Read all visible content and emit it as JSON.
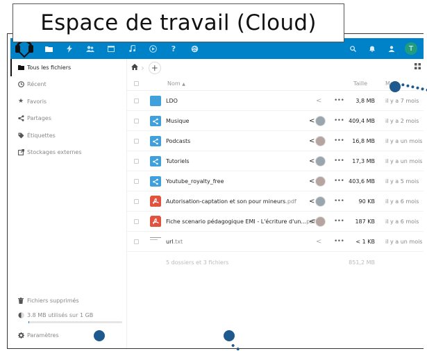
{
  "title": "Espace de travail (Cloud)",
  "topbar": {
    "nav_icons": [
      "files-icon",
      "activity-icon",
      "contacts-icon",
      "calendar-icon",
      "music-icon",
      "video-icon",
      "help-icon",
      "globe-icon"
    ],
    "right_icons": [
      "search-icon",
      "notifications-icon",
      "contacts-menu-icon"
    ],
    "avatar_letter": "T",
    "accent": "#0082c9"
  },
  "sidebar": {
    "items": [
      {
        "label": "Tous les fichiers",
        "icon": "folder-icon"
      },
      {
        "label": "Récent",
        "icon": "clock-icon"
      },
      {
        "label": "Favoris",
        "icon": "star-icon"
      },
      {
        "label": "Partages",
        "icon": "share-icon"
      },
      {
        "label": "Étiquettes",
        "icon": "tag-icon"
      },
      {
        "label": "Stockages externes",
        "icon": "external-icon"
      }
    ],
    "trash_label": "Fichiers supprimés",
    "quota_label": "3.8 MB utilisés sur 1 GB",
    "quota_fraction": 0.004,
    "settings_label": "Paramètres"
  },
  "table": {
    "col_name": "Nom",
    "col_size": "Taille",
    "col_modified": "Mo",
    "rows": [
      {
        "name": "LDO",
        "ext": "",
        "type": "folder",
        "shared": false,
        "size": "3,8 MB",
        "modified": "il y a 7 mois"
      },
      {
        "name": "Musique",
        "ext": "",
        "type": "shared",
        "shared": true,
        "size": "409,4 MB",
        "modified": "il y a 2 mois"
      },
      {
        "name": "Podcasts",
        "ext": "",
        "type": "shared",
        "shared": true,
        "size": "16,8 MB",
        "modified": "il y a un mois"
      },
      {
        "name": "Tutoriels",
        "ext": "",
        "type": "shared",
        "shared": true,
        "size": "17,3 MB",
        "modified": "il y a un mois"
      },
      {
        "name": "Youtube_royalty_free",
        "ext": "",
        "type": "shared",
        "shared": true,
        "size": "403,6 MB",
        "modified": "il y a 5 mois"
      },
      {
        "name": "Autorisation-captation et son pour mineurs",
        "ext": ".pdf",
        "type": "pdf",
        "shared": true,
        "size": "90 KB",
        "modified": "il y a 6 mois"
      },
      {
        "name": "Fiche scenario pédagogique EMI - L'écriture d'un...",
        "ext": "pdf",
        "type": "pdf",
        "shared": true,
        "size": "187 KB",
        "modified": "il y a 6 mois"
      },
      {
        "name": "url",
        "ext": ".txt",
        "type": "txt",
        "shared": false,
        "size": "< 1 KB",
        "modified": "il y a un mois"
      }
    ],
    "summary_count": "5 dossiers et 3 fichiers",
    "summary_size": "851,2 MB"
  }
}
